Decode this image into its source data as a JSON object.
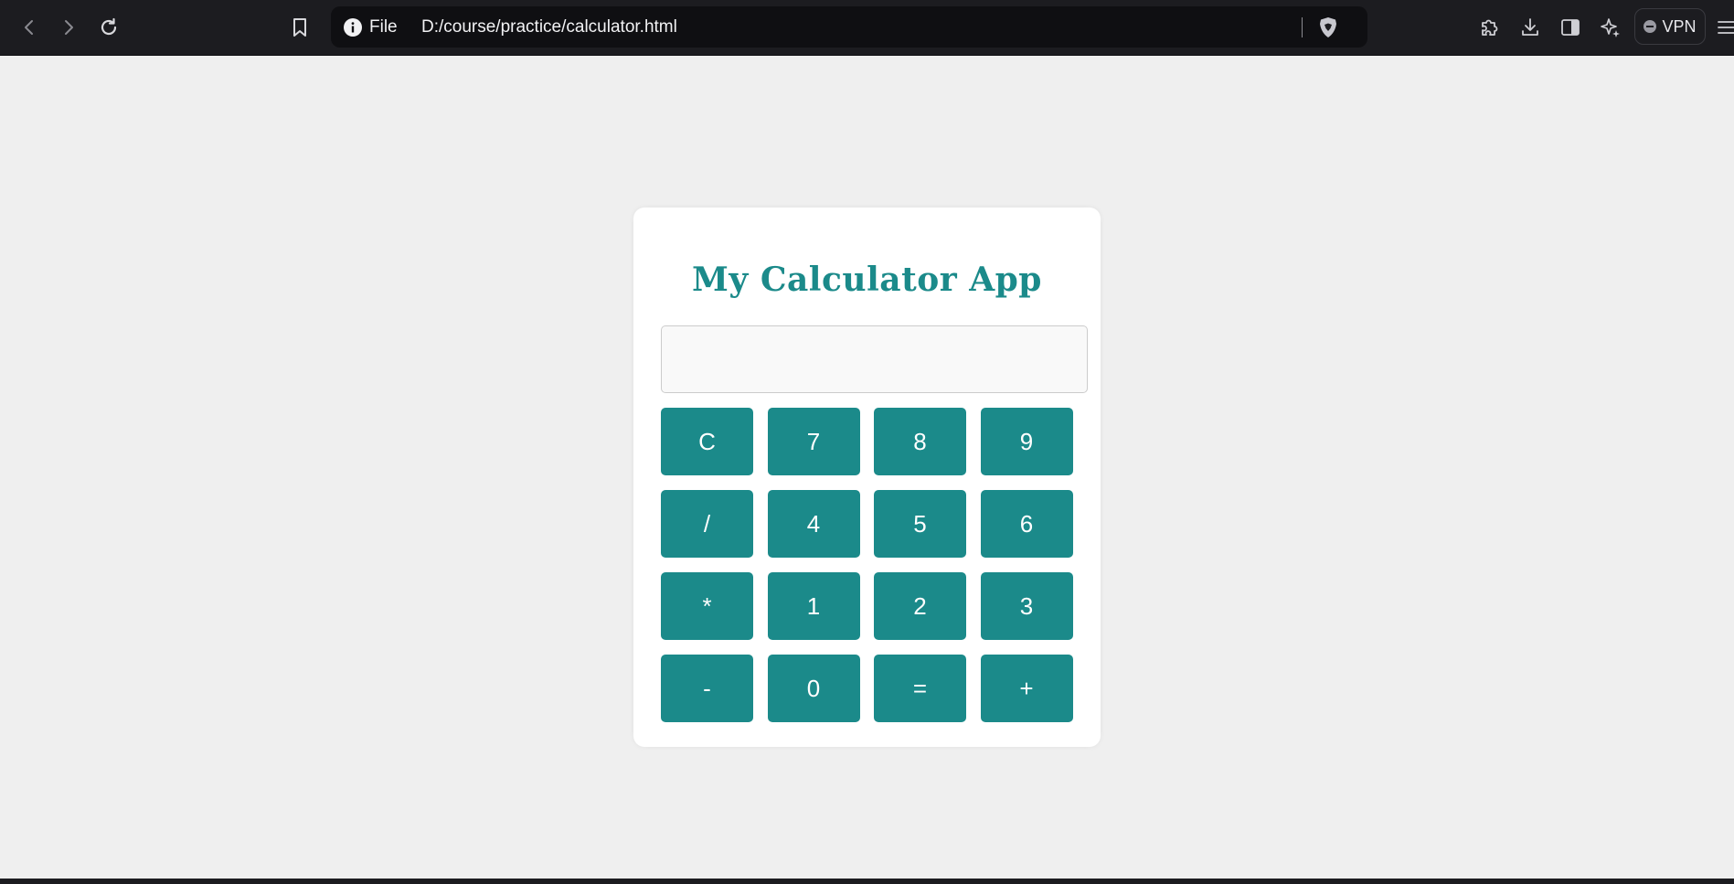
{
  "browser": {
    "url_scheme_label": "File",
    "url": "D:/course/practice/calculator.html",
    "vpn_label": "VPN",
    "icons": {
      "back": "back-arrow-icon",
      "forward": "forward-arrow-icon",
      "reload": "reload-icon",
      "bookmark": "bookmark-icon",
      "info": "info-icon",
      "shield": "brave-shield-icon",
      "extensions": "puzzle-icon",
      "downloads": "download-icon",
      "sidebar": "sidebar-icon",
      "leo": "sparkle-icon",
      "menu": "hamburger-menu-icon"
    }
  },
  "app": {
    "title": "My Calculator App",
    "display_value": "",
    "accent_color": "#1b8a8a",
    "keys": [
      "C",
      "7",
      "8",
      "9",
      "/",
      "4",
      "5",
      "6",
      "*",
      "1",
      "2",
      "3",
      "-",
      "0",
      "=",
      "+"
    ]
  }
}
